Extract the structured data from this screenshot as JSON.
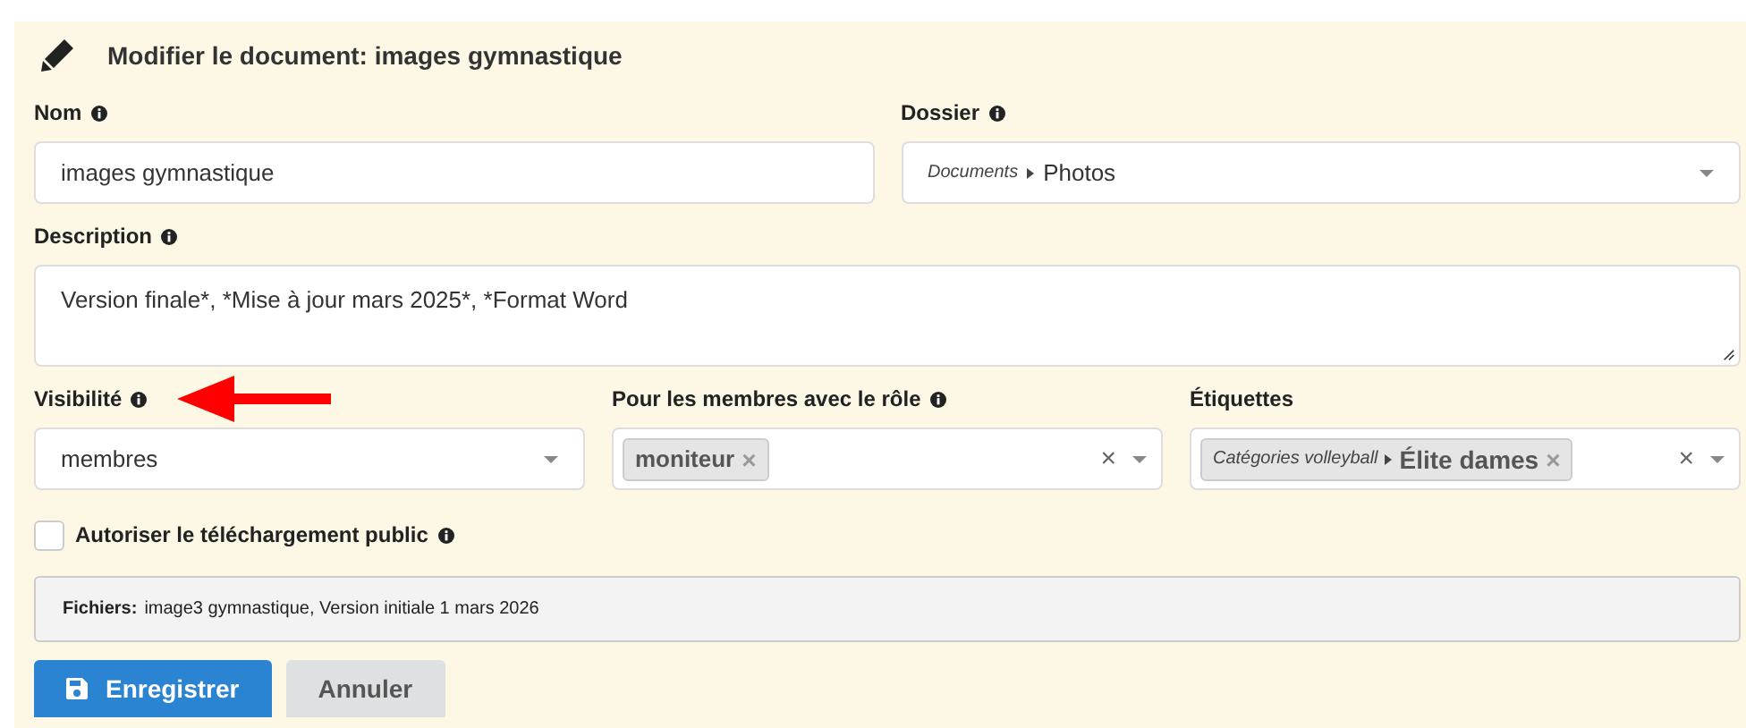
{
  "header": {
    "title": "Modifier le document: images gymnastique"
  },
  "rows": [
    {
      "fields": [
        {
          "kind": "text",
          "label": "Nom",
          "info": true,
          "value": "images gymnastique"
        },
        {
          "kind": "path-select",
          "label": "Dossier",
          "info": true,
          "path": "Documents",
          "value": "Photos"
        }
      ]
    },
    {
      "fields": [
        {
          "kind": "textarea",
          "label": "Description",
          "info": true,
          "value": "Version finale*, *Mise à jour mars 2025*, *Format Word"
        }
      ]
    },
    {
      "fields": [
        {
          "kind": "select",
          "label": "Visibilité",
          "info": true,
          "pointer": true,
          "value": "membres"
        },
        {
          "kind": "tags",
          "label": "Pour les membres avec le rôle",
          "info": true,
          "tags": [
            {
              "value": "moniteur",
              "remove": "×"
            }
          ],
          "clear": "×"
        },
        {
          "kind": "tags",
          "label": "Étiquettes",
          "tags": [
            {
              "path": "Catégories volleyball",
              "value": "Élite dames",
              "remove": "×"
            }
          ],
          "clear": "×"
        }
      ]
    }
  ],
  "public_download": {
    "label": "Autoriser le téléchargement public",
    "checked": false,
    "info": true
  },
  "files": {
    "label": "Fichiers:",
    "value": "image3 gymnastique, Version initiale 1 mars 2026"
  },
  "buttons": [
    {
      "kind": "primary",
      "label": "Enregistrer"
    },
    {
      "kind": "secondary",
      "label": "Annuler"
    }
  ]
}
